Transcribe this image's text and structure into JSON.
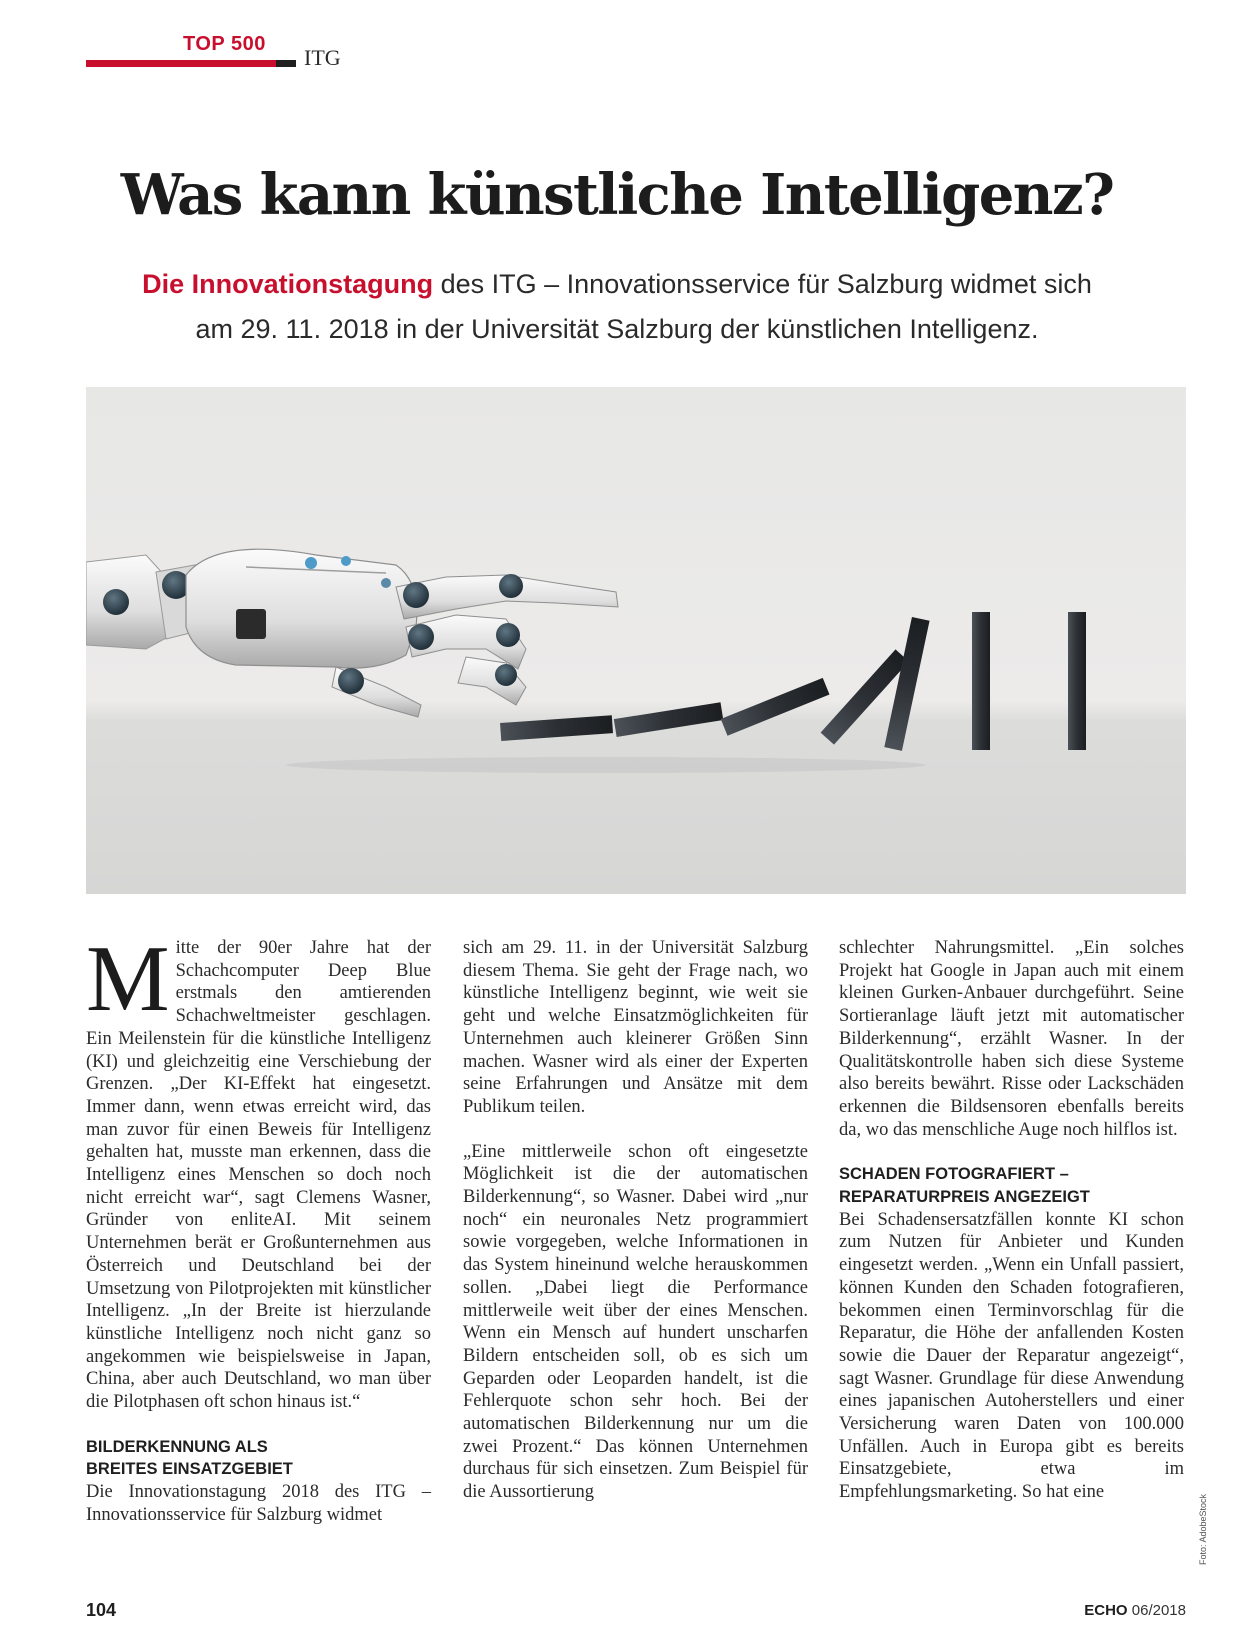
{
  "header": {
    "section": "TOP 500",
    "category": "ITG"
  },
  "title": "Was kann künstliche Intelligenz?",
  "deck": {
    "highlight": "Die Innovationstagung",
    "line1_rest": " des ITG – Innovationsservice für Salzburg widmet sich",
    "line2": "am 29. 11. 2018 in der Universität Salzburg der künstlichen Intelligenz."
  },
  "image": {
    "subject": "robot-hand-dominoes",
    "credit": "Foto: AdobeStock"
  },
  "article": {
    "dropcap": "M",
    "col1": {
      "p1": "itte der 90er Jahre hat der Schachcomputer Deep Blue erstmals den amtierenden Schachweltmeister geschlagen. Ein Meilenstein für die künstliche Intelligenz (KI) und gleichzeitig eine Verschiebung der Grenzen. „Der KI-Effekt hat eingesetzt. Immer dann, wenn etwas erreicht wird, das man zuvor für einen Beweis für Intelligenz gehalten hat, musste man erkennen, dass die Intelligenz eines Menschen so doch noch nicht erreicht war“, sagt Clemens Wasner, Gründer von enliteAI. Mit seinem Unternehmen berät er Großunternehmen aus Österreich und Deutschland bei der Umsetzung von Pilotprojekten mit künstlicher Intelligenz. „In der Breite ist hierzulande künstliche Intelligenz noch nicht ganz so angekommen wie beispielsweise in Japan, China, aber auch Deutschland, wo man über die Pilotphasen oft schon hinaus ist.“",
      "subhead_line1": "BILDERKENNUNG ALS",
      "subhead_line2": "BREITES EINSATZGEBIET",
      "p2": "Die Innovationstagung 2018 des ITG – Innovationsservice für Salzburg widmet"
    },
    "col2": {
      "p1": "sich am 29. 11. in der Universität Salzburg diesem Thema. Sie geht der Frage nach, wo künstliche Intelligenz beginnt, wie weit sie geht und welche Einsatzmöglichkeiten für Unternehmen auch kleinerer Größen Sinn machen. Wasner wird als einer der Experten seine Erfahrungen und Ansätze mit dem Publikum teilen.",
      "p2": "„Eine mittlerweile schon oft eingesetzte Möglichkeit ist die der automatischen Bilderkennung“, so Wasner. Dabei wird „nur noch“ ein neuronales Netz programmiert sowie vorgegeben, welche Informationen in das System hineinund welche herauskommen sollen. „Dabei liegt die Performance mittlerweile weit über der eines Menschen. Wenn ein Mensch auf hundert unscharfen Bildern entscheiden soll, ob es sich um Geparden oder Leoparden handelt, ist die Fehlerquote schon sehr hoch. Bei der automatischen Bilderkennung nur um die zwei Prozent.“ Das können Unternehmen durchaus für sich einsetzen. Zum Beispiel für die Aussortierung"
    },
    "col3": {
      "p1": "schlechter Nahrungsmittel. „Ein solches Projekt hat Google in Japan auch mit einem kleinen Gurken-Anbauer durchgeführt. Seine Sortieranlage läuft jetzt mit automatischer Bilderkennung“, erzählt Wasner. In der Qualitätskontrolle haben sich diese Systeme also bereits bewährt. Risse oder Lackschäden erkennen die Bildsensoren ebenfalls bereits da, wo das menschliche Auge noch hilflos ist.",
      "subhead_line1": "SCHADEN FOTOGRAFIERT –",
      "subhead_line2": "REPARATURPREIS ANGEZEIGT",
      "p2": "Bei Schadensersatzfällen konnte KI schon zum Nutzen für Anbieter und Kunden eingesetzt werden. „Wenn ein Unfall passiert, können Kunden den Schaden fotografieren, bekommen einen Terminvorschlag für die Reparatur, die Höhe der anfallenden Kosten sowie die Dauer der Reparatur angezeigt“, sagt Wasner. Grundlage für diese Anwendung eines japanischen Autoherstellers und einer Versicherung waren Daten von 100.000 Unfällen. Auch in Europa gibt es bereits Einsatzgebiete, etwa im Empfehlungsmarketing. So hat eine"
    }
  },
  "footer": {
    "page_number": "104",
    "magazine": "ECHO",
    "issue": "06/2018"
  }
}
